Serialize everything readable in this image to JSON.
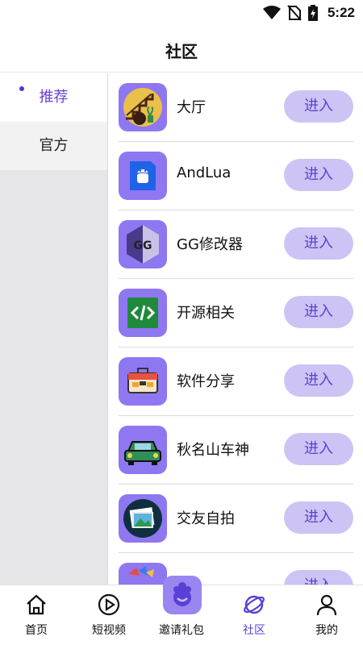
{
  "status_bar": {
    "time": "5:22",
    "icons": [
      "wifi-icon",
      "no-sim-icon",
      "battery-charging-icon"
    ]
  },
  "header": {
    "title": "社区"
  },
  "sidebar": {
    "items": [
      {
        "label": "推荐",
        "active": true
      },
      {
        "label": "官方",
        "active": false
      }
    ]
  },
  "list": {
    "items": [
      {
        "name": "大厅",
        "button": "进入",
        "icon": "staircase-icon"
      },
      {
        "name": "AndLua",
        "button": "进入",
        "icon": "android-file-icon"
      },
      {
        "name": "GG修改器",
        "button": "进入",
        "icon": "gg-icon"
      },
      {
        "name": "开源相关",
        "button": "进入",
        "icon": "code-icon"
      },
      {
        "name": "软件分享",
        "button": "进入",
        "icon": "toolbox-icon"
      },
      {
        "name": "秋名山车神",
        "button": "进入",
        "icon": "car-icon"
      },
      {
        "name": "交友自拍",
        "button": "进入",
        "icon": "photo-icon"
      },
      {
        "name": "",
        "button": "进入",
        "icon": "partial-icon"
      }
    ]
  },
  "bottom_nav": {
    "items": [
      {
        "label": "首页",
        "icon": "home-icon"
      },
      {
        "label": "短视频",
        "icon": "play-icon"
      },
      {
        "label": "邀请礼包",
        "icon": "gift-icon"
      },
      {
        "label": "社区",
        "icon": "planet-icon",
        "active": true
      },
      {
        "label": "我的",
        "icon": "person-icon"
      }
    ]
  },
  "colors": {
    "accent": "#5b3fd6",
    "button_bg": "#cdc3f5",
    "icon_bg": "#8f77f2"
  }
}
